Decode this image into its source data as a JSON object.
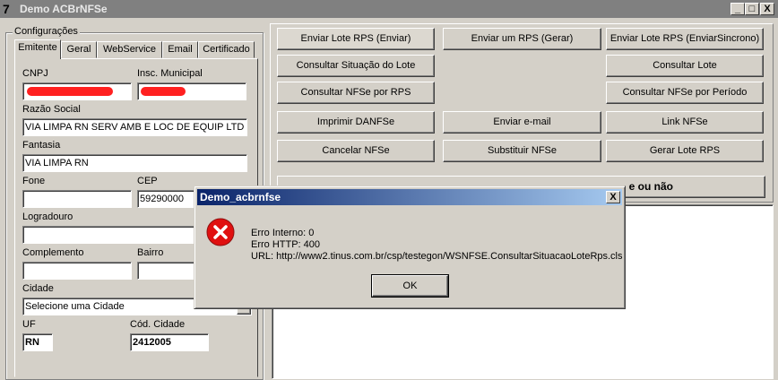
{
  "window": {
    "title": "Demo ACBrNFSe",
    "icon": "delphi-7-icon",
    "controls": {
      "minimize": "_",
      "maximize": "□",
      "close": "X"
    }
  },
  "config": {
    "group_label": "Configurações",
    "tabs": [
      "Emitente",
      "Geral",
      "WebService",
      "Email",
      "Certificado"
    ],
    "active_tab": "Emitente",
    "fields": {
      "cnpj": {
        "label": "CNPJ",
        "value": ""
      },
      "insc_municipal": {
        "label": "Insc. Municipal",
        "value": ""
      },
      "razao_social": {
        "label": "Razão Social",
        "value": "VIA LIMPA RN SERV AMB E LOC DE EQUIP LTD"
      },
      "fantasia": {
        "label": "Fantasia",
        "value": "VIA LIMPA RN"
      },
      "fone": {
        "label": "Fone",
        "value": ""
      },
      "cep": {
        "label": "CEP",
        "value": "59290000"
      },
      "logradouro": {
        "label": "Logradouro",
        "value": ""
      },
      "complemento": {
        "label": "Complemento",
        "value": ""
      },
      "bairro": {
        "label": "Bairro",
        "value": ""
      },
      "cidade": {
        "label": "Cidade",
        "value": "Selecione uma Cidade"
      },
      "uf": {
        "label": "UF",
        "value": "RN"
      },
      "cod_cidade": {
        "label": "Cód. Cidade",
        "value": "2412005"
      }
    }
  },
  "buttons": {
    "enviar_lote": "Enviar Lote RPS (Enviar)",
    "enviar_um": "Enviar um RPS (Gerar)",
    "enviar_sincrono": "Enviar Lote RPS (EnviarSincrono)",
    "consultar_situacao": "Consultar Situação do Lote",
    "consultar_lote": "Consultar Lote",
    "consultar_nfse_rps": "Consultar NFSe por RPS",
    "consultar_nfse_periodo": "Consultar NFSe por Período",
    "imprimir_danfse": "Imprimir DANFSe",
    "enviar_email": "Enviar e-mail",
    "link_nfse": "Link NFSe",
    "cancelar_nfse": "Cancelar NFSe",
    "substituir_nfse": "Substituir NFSe",
    "gerar_lote": "Gerar Lote RPS",
    "wide_button_visible": "e ou não"
  },
  "dialog": {
    "title": "Demo_acbrnfse",
    "icon": "error-icon",
    "close": "X",
    "lines": [
      "Erro Interno: 0",
      "Erro HTTP: 400",
      "URL: http://www2.tinus.com.br/csp/testegon/WSNFSE.ConsultarSituacaoLoteRps.cls"
    ],
    "ok_label": "OK"
  },
  "colors": {
    "error_red": "#e01010",
    "dialog_title_start": "#0a246a",
    "dialog_title_end": "#a6caf0",
    "face": "#d4d0c8"
  }
}
